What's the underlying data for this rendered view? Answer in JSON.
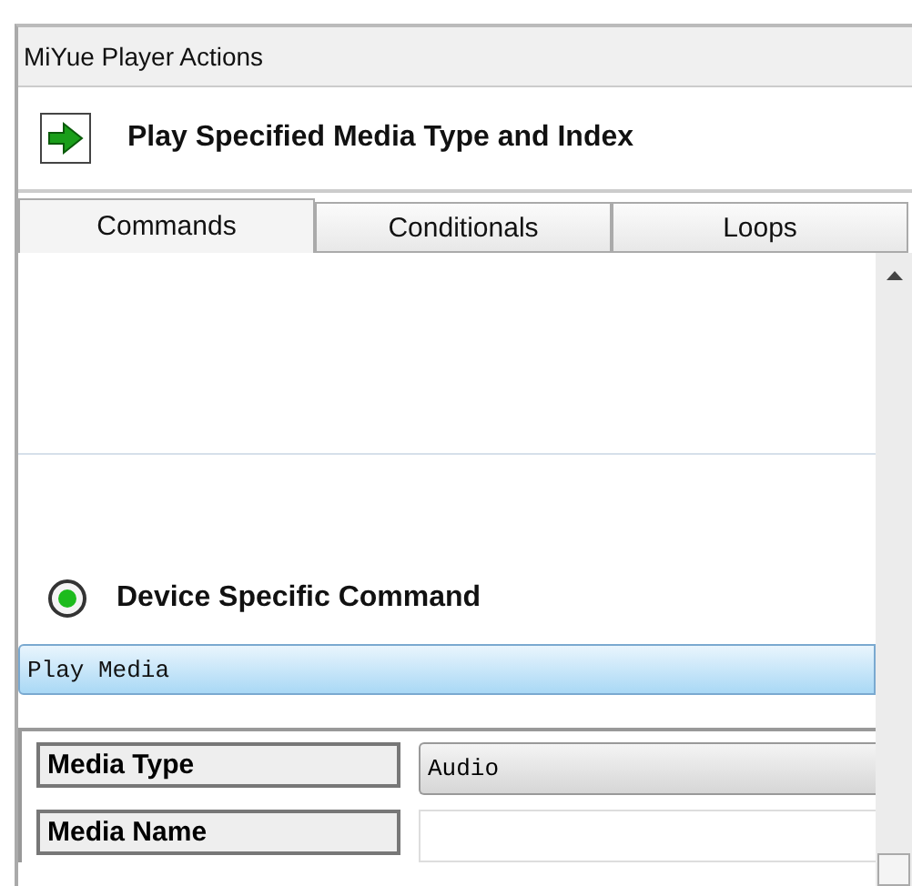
{
  "panel": {
    "title": "MiYue Player Actions"
  },
  "action": {
    "title": "Play Specified Media Type and Index"
  },
  "tabs": [
    {
      "label": "Commands",
      "selected": true
    },
    {
      "label": "Conditionals",
      "selected": false
    },
    {
      "label": "Loops",
      "selected": false
    }
  ],
  "command_option": {
    "label": "Device Specific Command",
    "selected": true
  },
  "command": {
    "value": "Play Media"
  },
  "properties": [
    {
      "kind": "dropdown",
      "label": "Media Type",
      "value": "Audio"
    },
    {
      "kind": "text",
      "label": "Media Name"
    }
  ]
}
